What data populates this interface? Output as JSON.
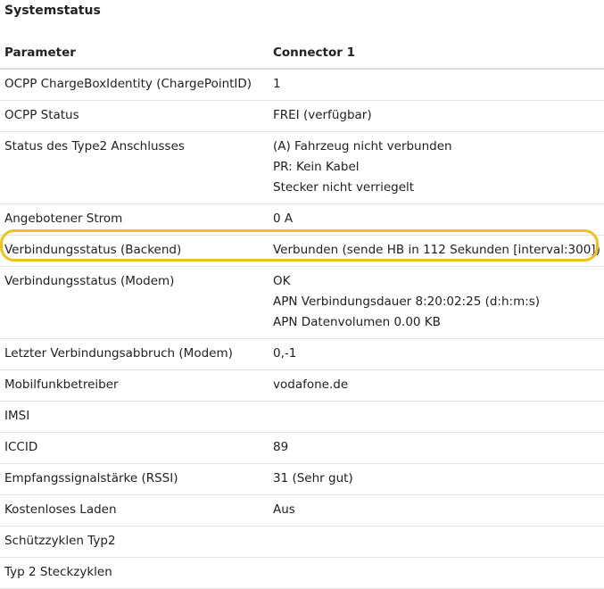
{
  "page": {
    "title": "Systemstatus"
  },
  "table": {
    "headers": [
      "Parameter",
      "Connector 1"
    ],
    "rows": [
      {
        "param": "OCPP ChargeBoxIdentity (ChargePointID)",
        "values": [
          "1"
        ]
      },
      {
        "param": "OCPP Status",
        "values": [
          "FREI (verfügbar)"
        ]
      },
      {
        "param": "Status des Type2 Anschlusses",
        "values": [
          "(A) Fahrzeug nicht verbunden",
          "PR: Kein Kabel",
          "Stecker nicht verriegelt"
        ]
      },
      {
        "param": "Angebotener Strom",
        "values": [
          "0 A"
        ]
      },
      {
        "param": "Verbindungsstatus (Backend)",
        "values": [
          "Verbunden (sende HB in 112 Sekunden [interval:300])"
        ]
      },
      {
        "param": "Verbindungsstatus (Modem)",
        "values": [
          "OK",
          "APN Verbindungsdauer 8:20:02:25 (d:h:m:s)",
          "APN Datenvolumen 0.00 KB"
        ]
      },
      {
        "param": "Letzter Verbindungsabbruch (Modem)",
        "values": [
          "0,-1"
        ]
      },
      {
        "param": "Mobilfunkbetreiber",
        "values": [
          "vodafone.de"
        ]
      },
      {
        "param": "IMSI",
        "values": [
          ""
        ]
      },
      {
        "param": "ICCID",
        "values": [
          "89"
        ]
      },
      {
        "param": "Empfangssignalstärke (RSSI)",
        "values": [
          "31 (Sehr gut)"
        ]
      },
      {
        "param": "Kostenloses Laden",
        "values": [
          "Aus"
        ]
      },
      {
        "param": "Schützzyklen Typ2",
        "values": [
          ""
        ]
      },
      {
        "param": "Typ 2 Steckzyklen",
        "values": [
          ""
        ]
      }
    ]
  },
  "colors": {
    "highlight": "#f2c21b"
  }
}
